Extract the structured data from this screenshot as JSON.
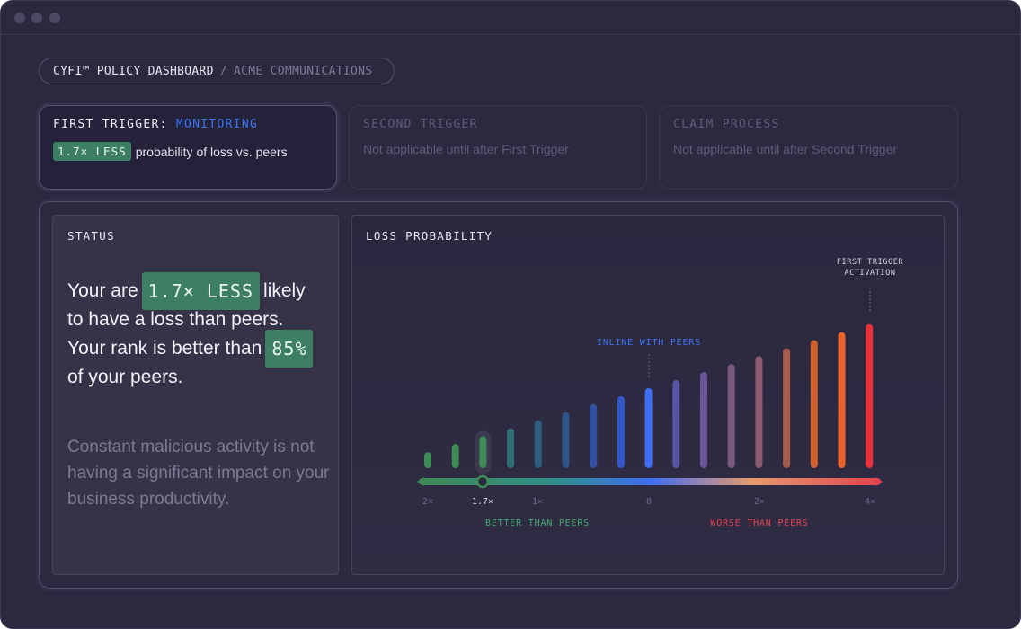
{
  "breadcrumb": {
    "main": "CYFI™ POLICY DASHBOARD",
    "separator": "/",
    "sub": "ACME COMMUNICATIONS"
  },
  "cards": [
    {
      "title": "FIRST TRIGGER:",
      "status": "MONITORING",
      "tag": "1.7× LESS",
      "body": "probability of loss vs. peers"
    },
    {
      "title": "SECOND TRIGGER",
      "body": "Not applicable until after First Trigger"
    },
    {
      "title": "CLAIM PROCESS",
      "body": "Not applicable until after Second Trigger"
    }
  ],
  "status": {
    "title": "STATUS",
    "line1_pre": "Your are",
    "tag1": "1.7× LESS",
    "line1_post": "likely",
    "line2": "to have a loss than peers.",
    "line3_pre": "Your rank is better than",
    "tag2": "85%",
    "line4": "of your peers.",
    "note": "Constant malicious activity is not having a significant impact on your business productivity."
  },
  "chart": {
    "title": "LOSS PROBABILITY",
    "trigger_label_1": "FIRST TRIGGER",
    "trigger_label_2": "ACTIVATION",
    "inline_label": "INLINE WITH PEERS",
    "better_label": "BETTER THAN PEERS",
    "worse_label": "WORSE THAN PEERS",
    "tick_labels": [
      "2×",
      "1.7×",
      "1×",
      "0",
      "2×",
      "4×"
    ]
  },
  "chart_data": {
    "type": "bar",
    "title": "LOSS PROBABILITY",
    "values": [
      2,
      3,
      4,
      5,
      6,
      7,
      8,
      9,
      10,
      11,
      12,
      13,
      14,
      15,
      16,
      17,
      18
    ],
    "colors": [
      "#3f8b55",
      "#3f8b55",
      "#3f8b55",
      "#2d6f73",
      "#2c5f7e",
      "#2f5488",
      "#3150a0",
      "#3358c8",
      "#3f6ef5",
      "#5756a5",
      "#6b5795",
      "#7a5880",
      "#8c5b6e",
      "#a55a4c",
      "#d0602e",
      "#e7652c",
      "#e7323a"
    ],
    "current_index": 2,
    "inline_index": 8,
    "trigger_index": 16,
    "x_ticks": [
      "2×",
      "1.7×",
      "1×",
      "0",
      "2×",
      "4×"
    ],
    "axis_scale": {
      "left": "BETTER THAN PEERS",
      "right": "WORSE THAN PEERS"
    },
    "annotations": [
      "INLINE WITH PEERS",
      "FIRST TRIGGER ACTIVATION"
    ]
  },
  "colors": {
    "accent_blue": "#3f74f2",
    "good_green": "#3c7f63",
    "bad_red": "#e0444e"
  }
}
